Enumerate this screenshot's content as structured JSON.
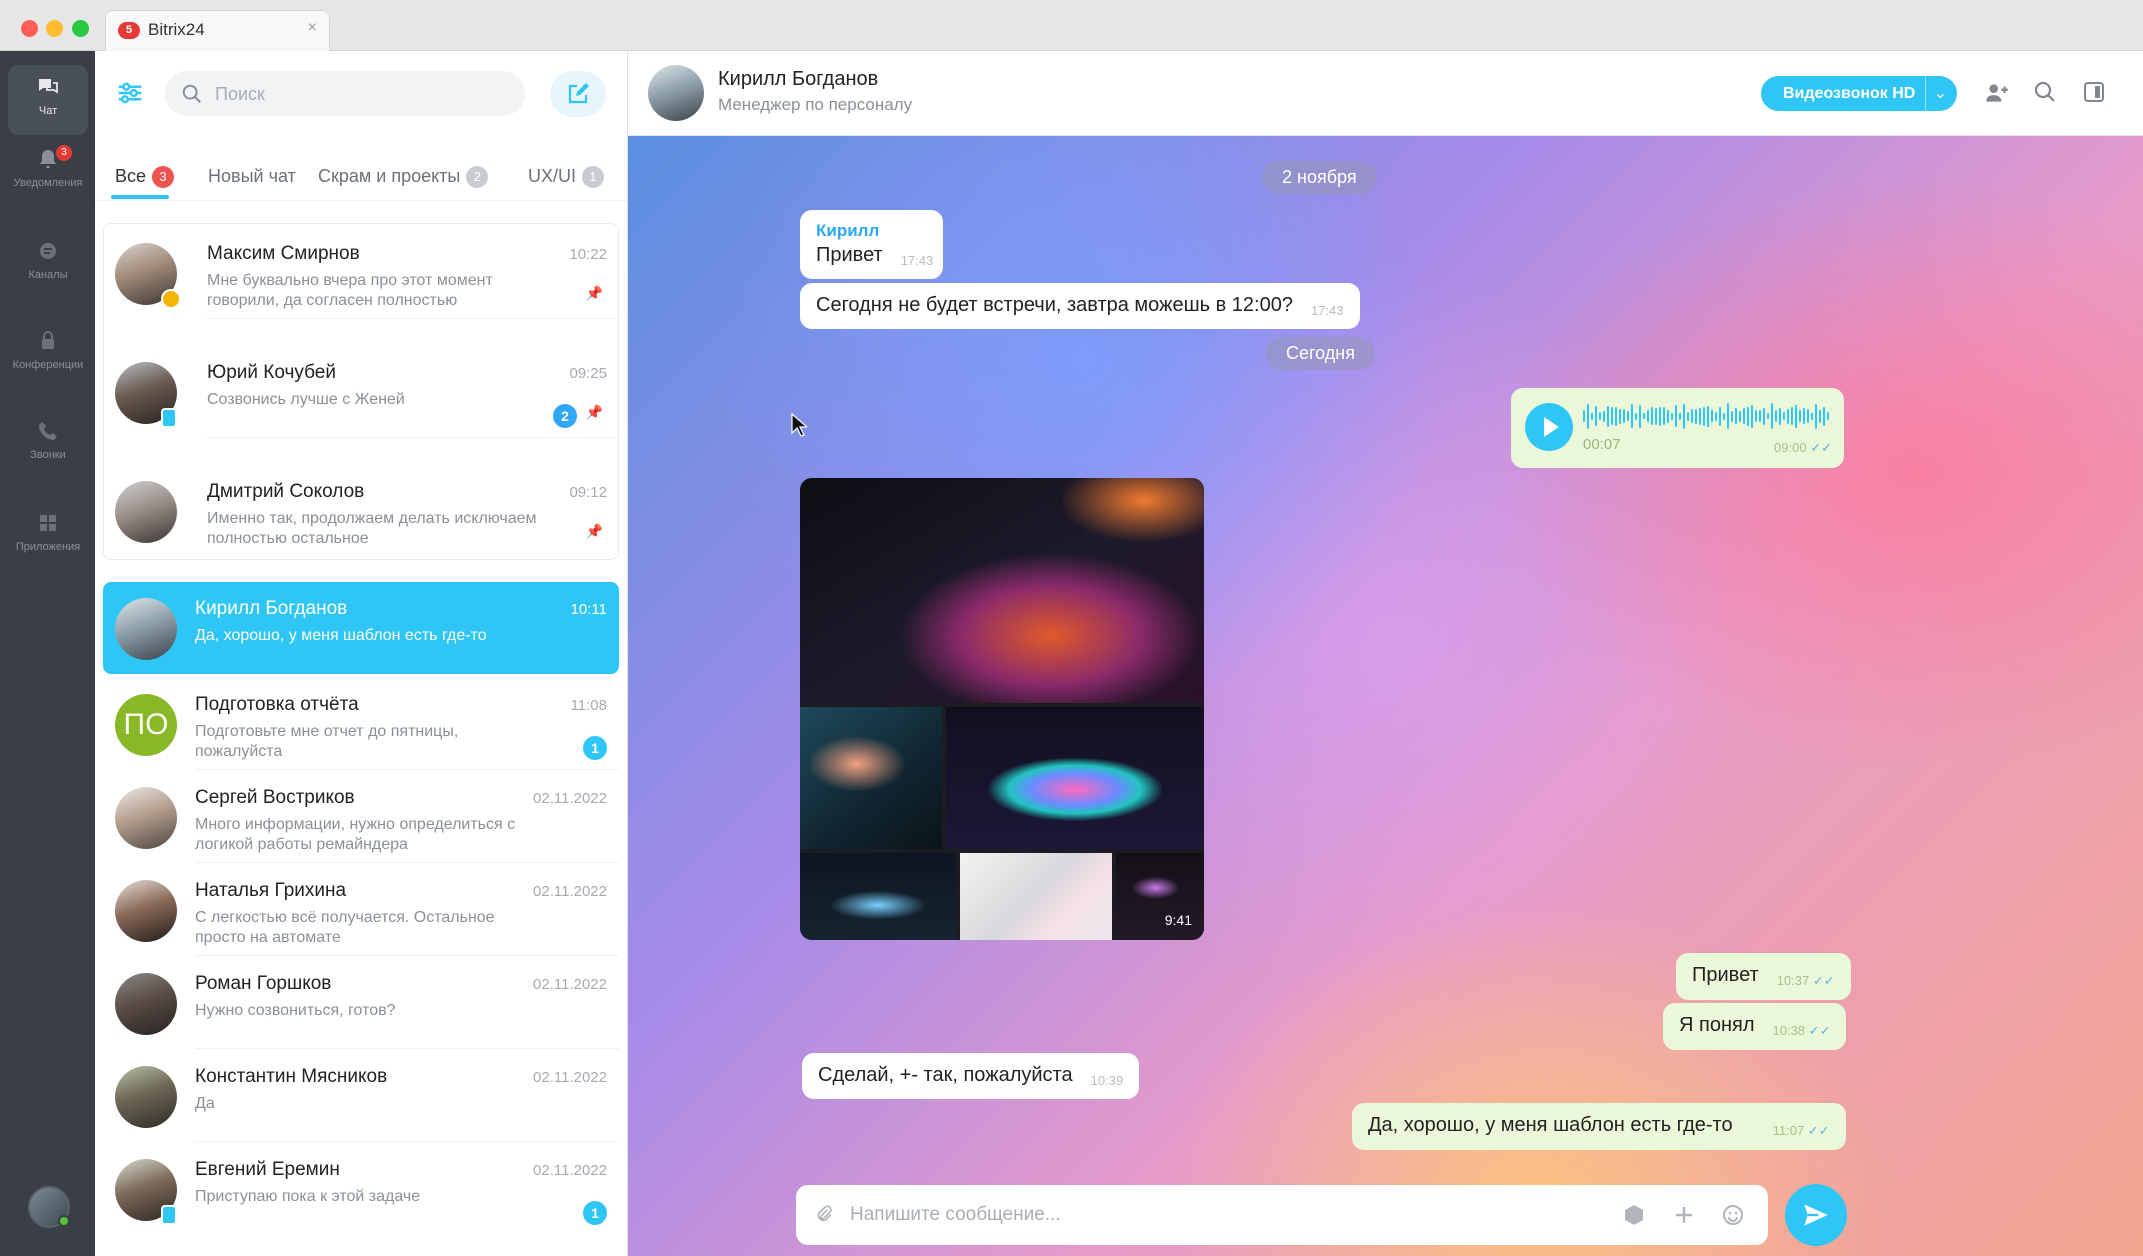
{
  "window": {
    "tab_badge": "5",
    "tab_title": "Bitrix24",
    "tab_close": "×"
  },
  "leftnav": {
    "items": [
      {
        "label": "Чат",
        "icon": "chat-icon"
      },
      {
        "label": "Уведомления",
        "icon": "bell-icon",
        "badge": "3"
      },
      {
        "label": "Каналы",
        "icon": "channels-icon"
      },
      {
        "label": "Конференции",
        "icon": "lock-icon"
      },
      {
        "label": "Звонки",
        "icon": "phone-icon"
      },
      {
        "label": "Приложения",
        "icon": "apps-icon"
      }
    ]
  },
  "sidebar": {
    "search_placeholder": "Поиск",
    "tabs": [
      {
        "label": "Все",
        "count": "3"
      },
      {
        "label": "Новый чат",
        "count": ""
      },
      {
        "label": "Скрам и проекты",
        "count": "2"
      },
      {
        "label": "UX/UI",
        "count": "1"
      }
    ],
    "chats": [
      {
        "name": "Максим Смирнов",
        "time": "10:22",
        "preview": "Мне буквально вчера про этот момент говорили, да согласен полностью",
        "pinned": true
      },
      {
        "name": "Юрий Кочубей",
        "time": "09:25",
        "preview": "Созвонись лучше с Женей",
        "unread": "2",
        "pinned": true
      },
      {
        "name": "Дмитрий Соколов",
        "time": "09:12",
        "preview": "Именно так, продолжаем делать исключаем полностью остальное",
        "pinned": true
      },
      {
        "name": "Кирилл Богданов",
        "time": "10:11",
        "preview": "Да, хорошо, у меня шаблон есть где-то"
      },
      {
        "name": "Подготовка отчёта",
        "time": "11:08",
        "preview": "Подготовьте мне отчет до пятницы, пожалуйста",
        "initials": "ПО",
        "unread": "1"
      },
      {
        "name": "Сергей Востриков",
        "time": "02.11.2022",
        "preview": "Много информации, нужно определиться с логикой работы ремайндера"
      },
      {
        "name": "Наталья Грихина",
        "time": "02.11.2022",
        "preview": "С легкостью всё получается. Остальное просто на автомате"
      },
      {
        "name": "Роман Горшков",
        "time": "02.11.2022",
        "preview": "Нужно созвониться, готов?"
      },
      {
        "name": "Константин Мясников",
        "time": "02.11.2022",
        "preview": "Да"
      },
      {
        "name": "Евгений Еремин",
        "time": "02.11.2022",
        "preview": "Приступаю пока к этой задаче",
        "unread": "1"
      }
    ]
  },
  "header": {
    "name": "Кирилл Богданов",
    "role": "Менеджер по персоналу",
    "video_button": "Видеозвонок HD",
    "video_dropdown": "⌄"
  },
  "messages": {
    "date1": "2 ноября",
    "date2": "Сегодня",
    "m1_sender": "Кирилл",
    "m1_text": "Привет",
    "m1_time": "17:43",
    "m2_text": "Сегодня не будет встречи, завтра можешь в 12:00?",
    "m2_time": "17:43",
    "voice_duration": "00:07",
    "voice_time": "09:00",
    "gallery_time": "9:41",
    "m3_text": "Привет",
    "m3_time": "10:37",
    "m4_text": "Я понял",
    "m4_time": "10:38",
    "m5_text": "Сделай,  +- так, пожалуйста",
    "m5_time": "10:39",
    "m6_text": "Да, хорошо, у меня шаблон есть где-то",
    "m6_time": "11:07",
    "check": "✓✓"
  },
  "composer": {
    "placeholder": "Напишите сообщение..."
  },
  "colors": {
    "accent": "#2fc6f6",
    "badge_red": "#ef5350",
    "outgoing_bubble": "#eaf7d9",
    "nav_bg": "#3a3f47"
  }
}
